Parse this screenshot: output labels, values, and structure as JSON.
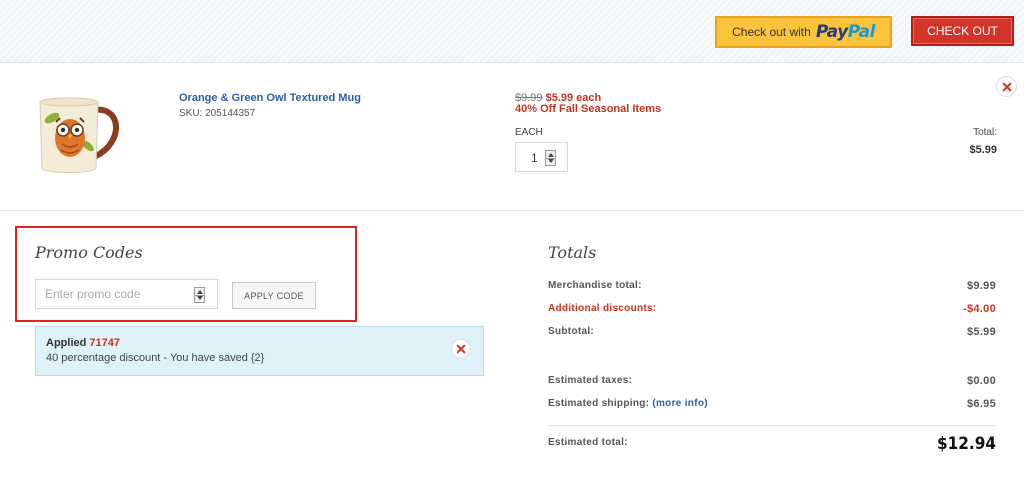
{
  "header": {
    "paypal_label": "Check out with",
    "paypal_logo_pay": "Pay",
    "paypal_logo_pal": "Pal",
    "checkout_label": "CHECK OUT"
  },
  "item": {
    "name": "Orange & Green Owl Textured Mug",
    "sku": "SKU: 205144357",
    "old_price": "$9.99",
    "new_price": "$5.99 each",
    "promo": "40% Off Fall Seasonal Items",
    "each_label": "EACH",
    "quantity": "1",
    "total_label": "Total:",
    "total_value": "$5.99"
  },
  "promo_codes": {
    "title": "Promo Codes",
    "placeholder": "Enter promo code",
    "apply_label": "APPLY CODE",
    "applied_prefix": "Applied",
    "applied_code": "71747",
    "applied_message": "40 percentage discount - You have saved {2}"
  },
  "totals": {
    "title": "Totals",
    "merchandise_label": "Merchandise total:",
    "merchandise_value": "$9.99",
    "discounts_label": "Additional discounts:",
    "discounts_value": "-$4.00",
    "subtotal_label": "Subtotal:",
    "subtotal_value": "$5.99",
    "taxes_label": "Estimated taxes:",
    "taxes_value": "$0.00",
    "shipping_label": "Estimated shipping:",
    "shipping_link": "(more info)",
    "shipping_value": "$6.95",
    "estimated_total_label": "Estimated total:",
    "estimated_total_value": "$12.94"
  },
  "colors": {
    "paypal_yellow": "#fcc43c",
    "checkout_red": "#d3342a",
    "link_blue": "#2b5fa8",
    "sale_red": "#c8321f",
    "applied_bg": "#dff1f9"
  },
  "icons": {
    "remove": "close-icon",
    "spinner": "up-down-spinner-icon",
    "product": "owl-mug-image"
  }
}
